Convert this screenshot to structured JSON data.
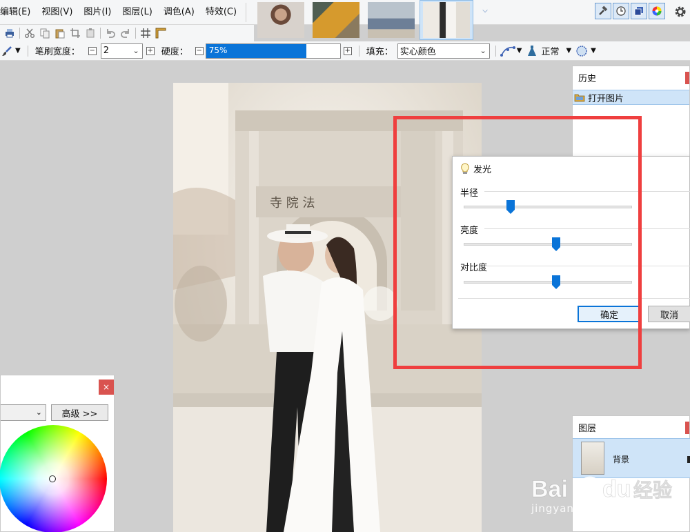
{
  "menu": {
    "items": [
      "编辑(E)",
      "视图(V)",
      "图片(I)",
      "图层(L)",
      "调色(A)",
      "特效(C)"
    ]
  },
  "thumbnails": [
    {
      "name": "thumbnail-1",
      "active": false
    },
    {
      "name": "thumbnail-2",
      "active": false
    },
    {
      "name": "thumbnail-3",
      "active": false
    },
    {
      "name": "thumbnail-4",
      "active": true
    }
  ],
  "options": {
    "brush_width_label": "笔刷宽度：",
    "brush_width_value": "2",
    "hardness_label": "硬度：",
    "hardness_value": "75%",
    "hardness_fraction": 0.75,
    "fill_label": "填充：",
    "fill_value": "实心颜色",
    "blend_value": "正常"
  },
  "history": {
    "title": "历史",
    "items": [
      "打开图片"
    ]
  },
  "glow_dialog": {
    "title": "发光",
    "radius_label": "半径",
    "radius_value": "6",
    "radius_fraction": 0.28,
    "brightness_label": "亮度",
    "brightness_value": "10",
    "brightness_fraction": 0.55,
    "contrast_label": "对比度",
    "contrast_value": "10",
    "contrast_fraction": 0.55,
    "ok_label": "确定",
    "cancel_label": "取消"
  },
  "color_panel": {
    "close_label": "×",
    "advanced_label": "高级 >>"
  },
  "layers": {
    "title": "图层",
    "items": [
      "背景"
    ]
  },
  "watermark": {
    "logo_text": "Bai du 经验",
    "url_text": "jingyan.baidu.com"
  },
  "colors": {
    "accent": "#0a74d8",
    "highlight": "#ef3f3f",
    "close_red": "#d9534f",
    "selection": "#cfe4f8"
  }
}
